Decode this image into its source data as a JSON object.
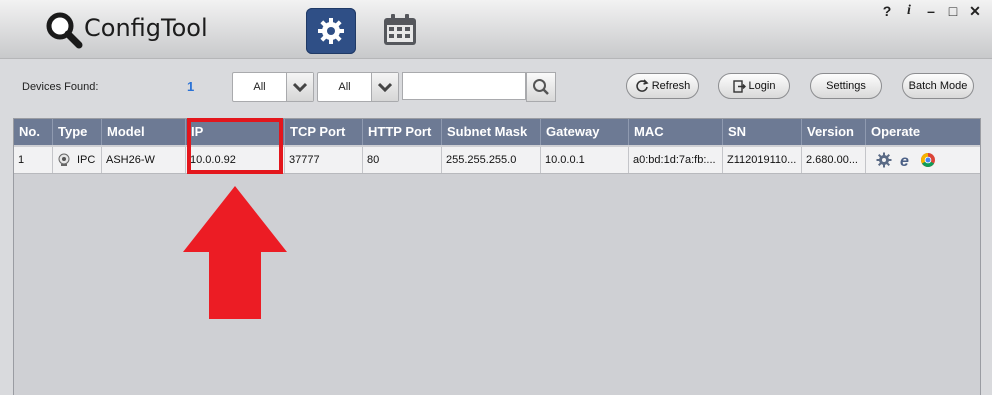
{
  "app": {
    "title": "ConfigTool"
  },
  "tabs": [
    {
      "name": "settings",
      "active": true
    },
    {
      "name": "calendar",
      "active": false
    }
  ],
  "window_controls": {
    "help": "?",
    "info": "i",
    "minimize": "–",
    "maximize": "□",
    "close": "✕"
  },
  "toolbar": {
    "devices_found_label": "Devices Found:",
    "devices_found_count": "1",
    "filter1_value": "All",
    "filter2_value": "All",
    "search_placeholder": "",
    "refresh_label": "Refresh",
    "login_label": "Login",
    "settings_label": "Settings",
    "batch_mode_label": "Batch Mode"
  },
  "table": {
    "columns": [
      "No.",
      "Type",
      "Model",
      "IP",
      "TCP Port",
      "HTTP Port",
      "Subnet Mask",
      "Gateway",
      "MAC",
      "SN",
      "Version",
      "Operate"
    ],
    "rows": [
      {
        "no": "1",
        "type": "IPC",
        "model": "ASH26-W",
        "ip": "10.0.0.92",
        "tcp_port": "37777",
        "http_port": "80",
        "subnet_mask": "255.255.255.0",
        "gateway": "10.0.0.1",
        "mac": "a0:bd:1d:7a:fb:...",
        "sn": "Z112019110...",
        "version": "2.680.00..."
      }
    ]
  },
  "colors": {
    "header_bg": "#6d7a94",
    "accent_blue": "#2a72d6",
    "highlight_red": "#e3161c",
    "active_tab": "#2f4f86"
  }
}
